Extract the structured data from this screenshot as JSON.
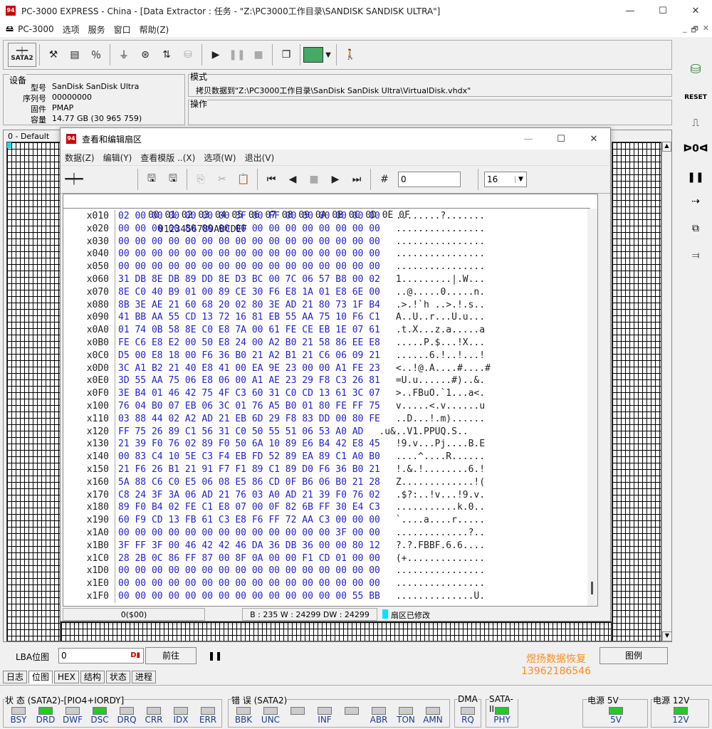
{
  "window": {
    "title": "PC-3000 EXPRESS - China - [Data Extractor : 任务 - \"Z:\\PC3000工作目录\\SANDISK SANDISK ULTRA\"]",
    "minimize": "—",
    "maximize": "☐",
    "close": "✕"
  },
  "menu": {
    "app": "PC-3000",
    "items": [
      "选项",
      "服务",
      "窗口",
      "帮助(Z)"
    ],
    "mdi": [
      "_",
      "🗗",
      "✕"
    ]
  },
  "toolbar": {
    "sata_label": "SATA2"
  },
  "device": {
    "group_title": "设备",
    "fields": [
      {
        "label": "型号",
        "value": "SanDisk SanDisk Ultra"
      },
      {
        "label": "序列号",
        "value": "00000000"
      },
      {
        "label": "固件",
        "value": "PMAP"
      },
      {
        "label": "容量",
        "value": "14.77 GB (30 965 759)"
      }
    ]
  },
  "mode": {
    "group_title": "模式",
    "text": "拷贝数据到\"Z:\\PC3000工作目录\\SanDisk SanDisk Ultra\\VirtualDisk.vhdx\""
  },
  "operation": {
    "group_title": "操作"
  },
  "default_label": "0 - Default",
  "dialog": {
    "title": "查看和编辑扇区",
    "menu": [
      "数据(Z)",
      "编辑(Y)",
      "查看模版 ..(X)",
      "选项(W)",
      "退出(V)"
    ],
    "sector_input": "0",
    "columns_select": "16",
    "hex_header_offsets": "00 01 02 03 04 05 06 07 08 09 0A 0B 0C 0D 0E 0F",
    "hex_header_ascii": "0123456789ABCDEF",
    "rows": [
      {
        "addr": "x010",
        "bytes": "02 00 00 00 00 00 00 3F 00 FF 00 00 00 00 00 00",
        "ascii": "........?......."
      },
      {
        "addr": "x020",
        "bytes": "00 00 00 00 80 00 00 00 00 00 00 00 00 00 00 00",
        "ascii": "................"
      },
      {
        "addr": "x030",
        "bytes": "00 00 00 00 00 00 00 00 00 00 00 00 00 00 00 00",
        "ascii": "................"
      },
      {
        "addr": "x040",
        "bytes": "00 00 00 00 00 00 00 00 00 00 00 00 00 00 00 00",
        "ascii": "................"
      },
      {
        "addr": "x050",
        "bytes": "00 00 00 00 00 00 00 00 00 00 00 00 00 00 00 00",
        "ascii": "................"
      },
      {
        "addr": "x060",
        "bytes": "31 DB 8E DB 89 DD 8E D3 BC 00 7C 06 57 B8 00 02",
        "ascii": "1.........|.W..."
      },
      {
        "addr": "x070",
        "bytes": "8E C0 40 B9 01 00 89 CE 30 F6 E8 1A 01 E8 6E 00",
        "ascii": "..@.....0.....n."
      },
      {
        "addr": "x080",
        "bytes": "8B 3E AE 21 60 68 20 02 80 3E AD 21 80 73 1F B4",
        "ascii": ".>.!`h ..>.!.s.."
      },
      {
        "addr": "x090",
        "bytes": "41 BB AA 55 CD 13 72 16 81 EB 55 AA 75 10 F6 C1",
        "ascii": "A..U..r...U.u..."
      },
      {
        "addr": "x0A0",
        "bytes": "01 74 0B 58 8E C0 E8 7A 00 61 FE CE EB 1E 07 61",
        "ascii": ".t.X...z.a.....a"
      },
      {
        "addr": "x0B0",
        "bytes": "FE C6 E8 E2 00 50 E8 24 00 A2 B0 21 58 86 EE E8",
        "ascii": ".....P.$...!X..."
      },
      {
        "addr": "x0C0",
        "bytes": "D5 00 E8 18 00 F6 36 B0 21 A2 B1 21 C6 06 09 21",
        "ascii": "......6.!..!...!"
      },
      {
        "addr": "x0D0",
        "bytes": "3C A1 B2 21 40 E8 41 00 EA 9E 23 00 00 A1 FE 23",
        "ascii": "<..!@.A....#....#"
      },
      {
        "addr": "x0E0",
        "bytes": "3D 55 AA 75 06 E8 06 00 A1 AE 23 29 F8 C3 26 81",
        "ascii": "=U.u......#)..&."
      },
      {
        "addr": "x0F0",
        "bytes": "3E B4 01 46 42 75 4F C3 60 31 C0 CD 13 61 3C 07",
        "ascii": ">..FBuO.`1...a<."
      },
      {
        "addr": "x100",
        "bytes": "76 04 B0 07 EB 06 3C 01 76 A5 B0 01 80 FE FF 75",
        "ascii": "v.....<.v......u"
      },
      {
        "addr": "x110",
        "bytes": "03 88 44 02 A2 AD 21 EB 6D 29 F8 83 DD 00 80 FE",
        "ascii": "..D...!.m)......"
      },
      {
        "addr": "x120",
        "bytes": "FF 75 26 89 C1 56 31 C0 50 55 51 06 53 A0 AD",
        "ascii": ".u&..V1.PPUQ.S.."
      },
      {
        "addr": "x130",
        "bytes": "21 39 F0 76 02 89 F0 50 6A 10 89 E6 B4 42 E8 45",
        "ascii": "!9.v...Pj....B.E"
      },
      {
        "addr": "x140",
        "bytes": "00 83 C4 10 5E C3 F4 EB FD 52 89 EA 89 C1 A0 B0",
        "ascii": "....^....R......"
      },
      {
        "addr": "x150",
        "bytes": "21 F6 26 B1 21 91 F7 F1 89 C1 89 D0 F6 36 B0 21",
        "ascii": "!.&.!........6.!"
      },
      {
        "addr": "x160",
        "bytes": "5A 88 C6 C0 E5 06 08 E5 86 CD 0F B6 06 B0 21 28",
        "ascii": "Z.............!("
      },
      {
        "addr": "x170",
        "bytes": "C8 24 3F 3A 06 AD 21 76 03 A0 AD 21 39 F0 76 02",
        "ascii": ".$?:..!v...!9.v."
      },
      {
        "addr": "x180",
        "bytes": "89 F0 B4 02 FE C1 E8 07 00 0F 82 6B FF 30 E4 C3",
        "ascii": "...........k.0.."
      },
      {
        "addr": "x190",
        "bytes": "60 F9 CD 13 FB 61 C3 E8 F6 FF 72 AA C3 00 00 00",
        "ascii": "`....a....r....."
      },
      {
        "addr": "x1A0",
        "bytes": "00 00 00 00 00 00 00 00 00 00 00 00 00 3F 00 00",
        "ascii": ".............?.."
      },
      {
        "addr": "x1B0",
        "bytes": "3F FF 3F 00 46 42 42 46 DA 36 DB 36 00 00 80 12",
        "ascii": "?.?.FBBF.6.6...."
      },
      {
        "addr": "x1C0",
        "bytes": "28 2B 0C 86 FF 87 00 8F 0A 00 00 F1 CD 01 00 00",
        "ascii": "(+.............."
      },
      {
        "addr": "x1D0",
        "bytes": "00 00 00 00 00 00 00 00 00 00 00 00 00 00 00 00",
        "ascii": "................"
      },
      {
        "addr": "x1E0",
        "bytes": "00 00 00 00 00 00 00 00 00 00 00 00 00 00 00 00",
        "ascii": "................"
      },
      {
        "addr": "x1F0",
        "bytes": "00 00 00 00 00 00 00 00 00 00 00 00 00 00 55 BB",
        "ascii": "..............U."
      }
    ],
    "status_offset": "0($00)",
    "status_bwd": "B : 235 W : 24299 DW : 24299",
    "status_modified": "扇区已修改"
  },
  "lba": {
    "label": "LBA位图",
    "value": "0",
    "goto": "前往",
    "legend": "图例"
  },
  "bottom_tabs": [
    "日志",
    "位图",
    "HEX",
    "结构",
    "状态",
    "进程"
  ],
  "watermark": {
    "line1": "煜扬数据恢复",
    "line2": "13962186546"
  },
  "status_group": {
    "title": "状 态 (SATA2)-[PIO4+IORDY]",
    "leds": [
      {
        "name": "BSY",
        "on": false
      },
      {
        "name": "DRD",
        "on": true
      },
      {
        "name": "DWF",
        "on": false
      },
      {
        "name": "DSC",
        "on": true
      },
      {
        "name": "DRQ",
        "on": false
      },
      {
        "name": "CRR",
        "on": false
      },
      {
        "name": "IDX",
        "on": false
      },
      {
        "name": "ERR",
        "on": false
      }
    ]
  },
  "error_group": {
    "title": "错 误 (SATA2)",
    "leds": [
      {
        "name": "BBK",
        "on": false
      },
      {
        "name": "UNC",
        "on": false
      },
      {
        "name": "",
        "on": false
      },
      {
        "name": "INF",
        "on": false
      },
      {
        "name": "",
        "on": false
      },
      {
        "name": "ABR",
        "on": false
      },
      {
        "name": "TON",
        "on": false
      },
      {
        "name": "AMN",
        "on": false
      }
    ]
  },
  "dma_group": {
    "title": "DMA",
    "led": "RQ"
  },
  "sata_group": {
    "title": "SATA-II",
    "led": "PHY"
  },
  "power5": {
    "title": "电源 5V",
    "led": "5V"
  },
  "power12": {
    "title": "电源 12V",
    "led": "12V"
  },
  "colors": {
    "led_on": "#22cc22",
    "hex_text": "#2222cc",
    "watermark": "#ff8c1a"
  }
}
